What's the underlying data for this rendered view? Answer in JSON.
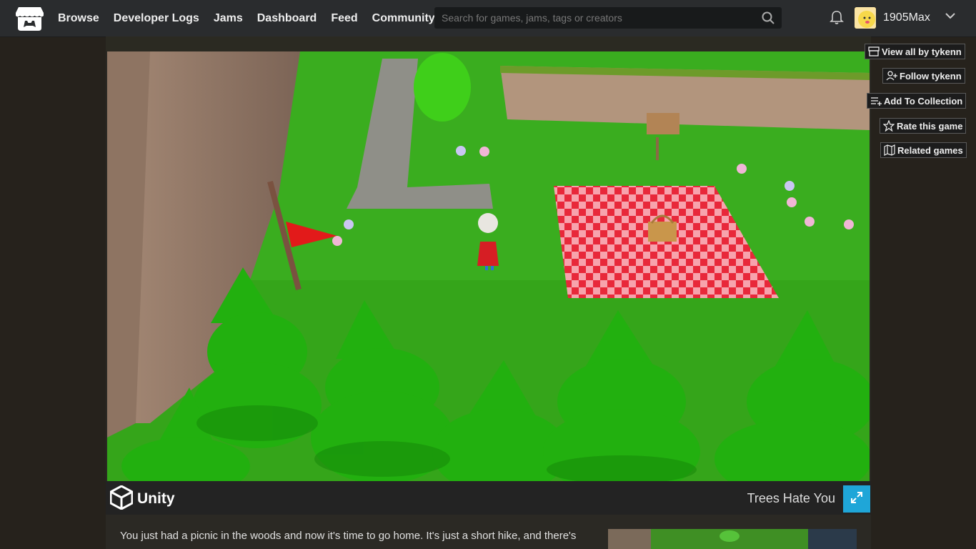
{
  "header": {
    "nav": [
      "Browse",
      "Developer Logs",
      "Jams",
      "Dashboard",
      "Feed",
      "Community"
    ],
    "search_placeholder": "Search for games, jams, tags or creators",
    "username": "1905Max"
  },
  "side_buttons": {
    "view_all": "View all by tykenn",
    "follow": "Follow tykenn",
    "add_collection": "Add To Collection",
    "rate": "Rate this game",
    "related": "Related games"
  },
  "player": {
    "engine_label": "Unity",
    "game_title": "Trees Hate You"
  },
  "description": "You just had a picnic in the woods and now it's time to go home. It's just a short hike, and there's",
  "colors": {
    "accent": "#1fa6d8",
    "grass": "#3aa51c",
    "header_bg": "#2a2c2e"
  }
}
